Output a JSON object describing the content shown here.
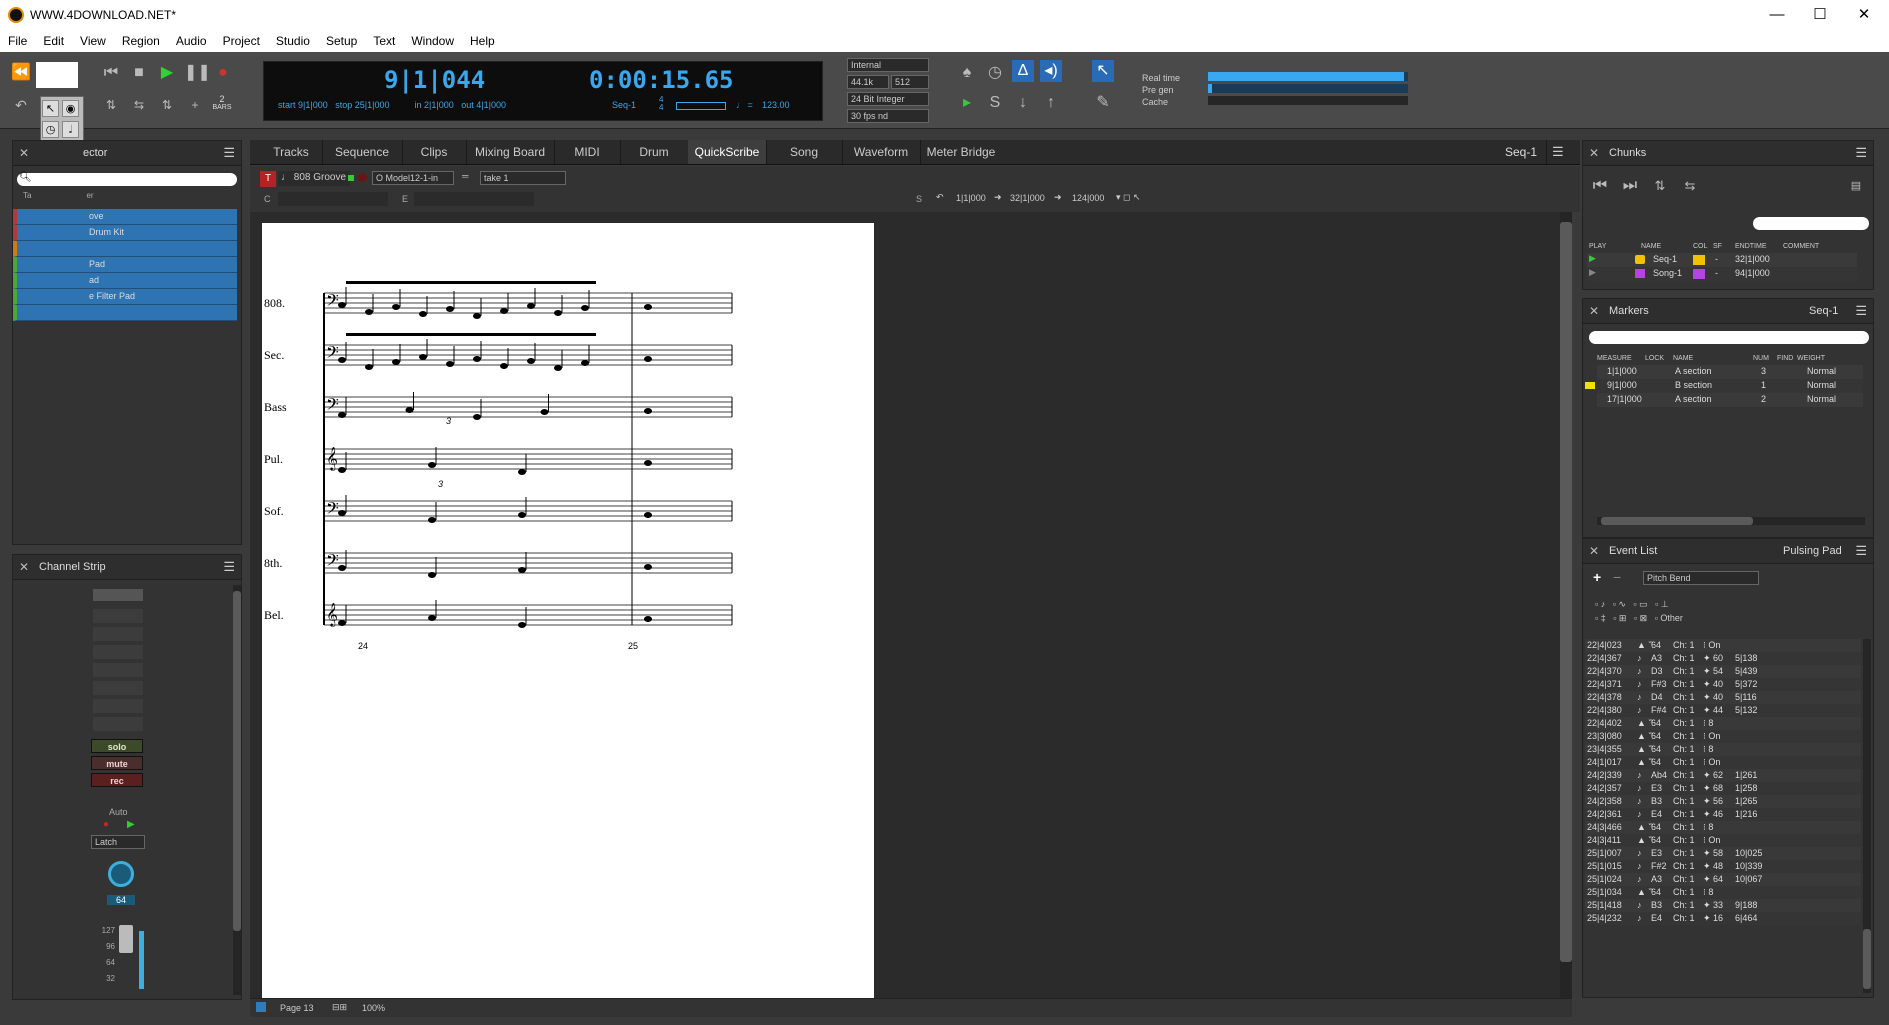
{
  "window": {
    "title": "WWW.4DOWNLOAD.NET*",
    "minimize": "—",
    "maximize": "☐",
    "close": "✕"
  },
  "menu": [
    "File",
    "Edit",
    "View",
    "Region",
    "Audio",
    "Project",
    "Studio",
    "Setup",
    "Text",
    "Window",
    "Help"
  ],
  "transport": {
    "bars_value": "2",
    "bars_label": "BARS",
    "position_measure": "9|1|044",
    "position_time": "0:00:15.65",
    "start_label": "start",
    "start_value": "9|1|000",
    "stop_label": "stop",
    "stop_value": "25|1|000",
    "in_label": "in",
    "in_value": "2|1|000",
    "out_label": "out",
    "out_value": "4|1|000",
    "seq": "Seq-1",
    "meter_top": "4",
    "meter_bottom": "4",
    "tempo": "123.00",
    "sync": "Internal",
    "sample_rate": "44.1k",
    "buffer": "512",
    "bit_depth": "24 Bit Integer",
    "fps": "30 fps nd",
    "realtime_label": "Real time",
    "pregen_label": "Pre gen",
    "cache_label": "Cache",
    "realtime_level": 0.98,
    "pregen_level": 0.02,
    "cache_level": 0.0
  },
  "tracks_panel": {
    "title": "ector",
    "items": [
      "ove",
      "Drum Kit",
      "",
      "Pad",
      "ad",
      "e Filter Pad",
      ""
    ],
    "header_fragment": "Ta",
    "header_fragment2": "er"
  },
  "channel_strip": {
    "title": "Channel Strip",
    "solo": "solo",
    "mute": "mute",
    "rec": "rec",
    "auto_label": "Auto",
    "automation_mode": "Latch",
    "pan_value": "64",
    "fader_ticks": [
      "127",
      "96",
      "64",
      "32"
    ]
  },
  "tabs": [
    "Tracks",
    "Sequence",
    "Clips",
    "Mixing Board",
    "MIDI",
    "Drum",
    "QuickScribe",
    "Song",
    "Waveform",
    "Meter Bridge"
  ],
  "active_tab": "QuickScribe",
  "seq_selector": "Seq-1",
  "editor_toolbar": {
    "track_name": "808 Groove",
    "input": "Model12-1-in",
    "take": "take 1",
    "start": "1|1|000",
    "mid": "32|1|000",
    "end": "124|000",
    "c_label": "C",
    "e_label": "E",
    "s_label": "S"
  },
  "score": {
    "staves": [
      "808.",
      "Sec.",
      "Bass",
      "Pul.",
      "Sof.",
      "8th.",
      "Bel."
    ],
    "measure_numbers": [
      "24",
      "25"
    ],
    "tuplet": "3"
  },
  "status_bar": {
    "page": "Page  13",
    "zoom": "100%"
  },
  "chunks": {
    "title": "Chunks",
    "headers": [
      "PLAY",
      "NAME",
      "COL",
      "SF",
      "ENDTIME",
      "COMMENT"
    ],
    "rows": [
      {
        "name": "Seq-1",
        "color": "#f2c200",
        "sf": "-",
        "endtime": "32|1|000"
      },
      {
        "name": "Song-1",
        "color": "#b444e8",
        "sf": "-",
        "endtime": "94|1|000"
      }
    ]
  },
  "markers": {
    "title": "Markers",
    "seq": "Seq-1",
    "headers": [
      "MEASURE",
      "LOCK",
      "NAME",
      "NUM",
      "FIND",
      "WEIGHT"
    ],
    "rows": [
      {
        "measure": "1|1|000",
        "name": "A section",
        "num": "3",
        "weight": "Normal"
      },
      {
        "measure": "9|1|000",
        "name": "B section",
        "num": "1",
        "weight": "Normal"
      },
      {
        "measure": "17|1|000",
        "name": "A section",
        "num": "2",
        "weight": "Normal"
      }
    ]
  },
  "event_list": {
    "title": "Event List",
    "track": "Pulsing Pad",
    "filter": "Pitch Bend",
    "other_label": "Other",
    "rows": [
      {
        "t": "22|4|023",
        "type": "▲ ‷",
        "note": "64",
        "ch": "Ch: 1",
        "v1": "⁝ On",
        "v2": ""
      },
      {
        "t": "22|4|367",
        "type": "♪",
        "note": "A3",
        "ch": "Ch: 1",
        "v1": "✦ 60",
        "v2": "5|138"
      },
      {
        "t": "22|4|370",
        "type": "♪",
        "note": "D3",
        "ch": "Ch: 1",
        "v1": "✦ 54",
        "v2": "5|439"
      },
      {
        "t": "22|4|371",
        "type": "♪",
        "note": "F#3",
        "ch": "Ch: 1",
        "v1": "✦ 40",
        "v2": "5|372"
      },
      {
        "t": "22|4|378",
        "type": "♪",
        "note": "D4",
        "ch": "Ch: 1",
        "v1": "✦ 40",
        "v2": "5|116"
      },
      {
        "t": "22|4|380",
        "type": "♪",
        "note": "F#4",
        "ch": "Ch: 1",
        "v1": "✦ 44",
        "v2": "5|132"
      },
      {
        "t": "22|4|402",
        "type": "▲ ‷",
        "note": "64",
        "ch": "Ch: 1",
        "v1": "⁝ 8",
        "v2": ""
      },
      {
        "t": "23|3|080",
        "type": "▲ ‷",
        "note": "64",
        "ch": "Ch: 1",
        "v1": "⁝ On",
        "v2": ""
      },
      {
        "t": "23|4|355",
        "type": "▲ ‷",
        "note": "64",
        "ch": "Ch: 1",
        "v1": "⁝ 8",
        "v2": ""
      },
      {
        "t": "24|1|017",
        "type": "▲ ‷",
        "note": "64",
        "ch": "Ch: 1",
        "v1": "⁝ On",
        "v2": ""
      },
      {
        "t": "24|2|339",
        "type": "♪",
        "note": "Ab4",
        "ch": "Ch: 1",
        "v1": "✦ 62",
        "v2": "1|261"
      },
      {
        "t": "24|2|357",
        "type": "♪",
        "note": "E3",
        "ch": "Ch: 1",
        "v1": "✦ 68",
        "v2": "1|258"
      },
      {
        "t": "24|2|358",
        "type": "♪",
        "note": "B3",
        "ch": "Ch: 1",
        "v1": "✦ 56",
        "v2": "1|265"
      },
      {
        "t": "24|2|361",
        "type": "♪",
        "note": "E4",
        "ch": "Ch: 1",
        "v1": "✦ 46",
        "v2": "1|216"
      },
      {
        "t": "24|3|466",
        "type": "▲ ‷",
        "note": "64",
        "ch": "Ch: 1",
        "v1": "⁝ 8",
        "v2": ""
      },
      {
        "t": "24|3|411",
        "type": "▲ ‷",
        "note": "64",
        "ch": "Ch: 1",
        "v1": "⁝ On",
        "v2": ""
      },
      {
        "t": "25|1|007",
        "type": "♪",
        "note": "E3",
        "ch": "Ch: 1",
        "v1": "✦ 58",
        "v2": "10|025"
      },
      {
        "t": "25|1|015",
        "type": "♪",
        "note": "F#2",
        "ch": "Ch: 1",
        "v1": "✦ 48",
        "v2": "10|339"
      },
      {
        "t": "25|1|024",
        "type": "♪",
        "note": "A3",
        "ch": "Ch: 1",
        "v1": "✦ 64",
        "v2": "10|067"
      },
      {
        "t": "25|1|034",
        "type": "▲ ‷",
        "note": "64",
        "ch": "Ch: 1",
        "v1": "⁝ 8",
        "v2": ""
      },
      {
        "t": "25|1|418",
        "type": "♪",
        "note": "B3",
        "ch": "Ch: 1",
        "v1": "✦ 33",
        "v2": "9|188"
      },
      {
        "t": "25|4|232",
        "type": "♪",
        "note": "E4",
        "ch": "Ch: 1",
        "v1": "✦ 16",
        "v2": "6|464"
      }
    ]
  }
}
